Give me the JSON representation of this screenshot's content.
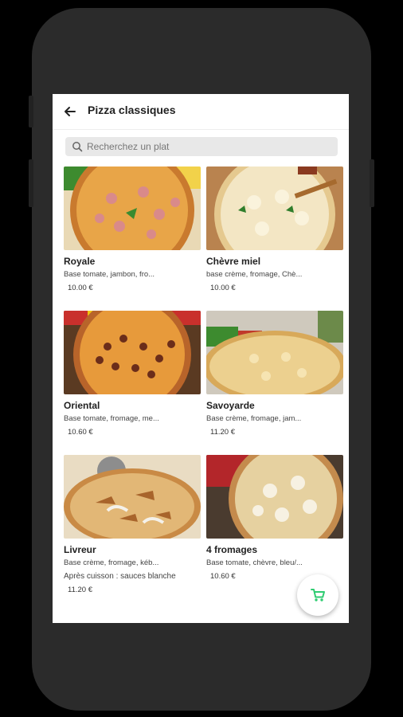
{
  "header": {
    "title": "Pizza classiques"
  },
  "search": {
    "placeholder": "Recherchez un plat"
  },
  "items": [
    {
      "name": "Royale",
      "description": "Base tomate, jambon, fro...",
      "price": "10.00 €"
    },
    {
      "name": "Chèvre miel",
      "description": "base crème, fromage, Chè...",
      "price": "10.00 €"
    },
    {
      "name": "Oriental",
      "description": "Base tomate, fromage, me...",
      "price": "10.60 €"
    },
    {
      "name": "Savoyarde",
      "description": "Base crème, fromage, jam...",
      "price": "11.20 €"
    },
    {
      "name": "Livreur",
      "description": "Base crème, fromage, kéb...",
      "extra": "Après cuisson : sauces blanche",
      "price": "11.20 €"
    },
    {
      "name": "4 fromages",
      "description": "Base tomate, chèvre, bleu/...",
      "price": "10.60 €"
    }
  ],
  "cart_button": {
    "icon": "cart-icon",
    "color": "#2ecc71"
  }
}
